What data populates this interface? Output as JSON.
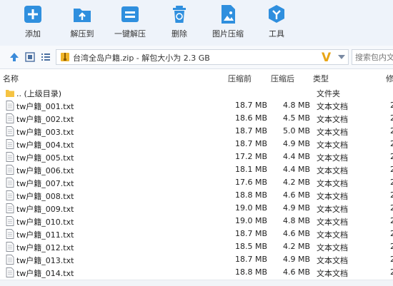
{
  "toolbar": {
    "items": [
      {
        "label": "添加",
        "icon": "add-icon"
      },
      {
        "label": "解压到",
        "icon": "extract-to-icon"
      },
      {
        "label": "一键解压",
        "icon": "one-click-extract-icon"
      },
      {
        "label": "删除",
        "icon": "delete-icon"
      },
      {
        "label": "图片压缩",
        "icon": "image-compress-icon"
      },
      {
        "label": "工具",
        "icon": "tools-icon"
      }
    ]
  },
  "address": {
    "path": "台湾全岛户籍.zip - 解包大小为 2.3 GB",
    "search_placeholder": "搜索包内文件",
    "search_value": ""
  },
  "columns": {
    "name": "名称",
    "size": "压缩前",
    "compressed": "压缩后",
    "type": "类型",
    "modified": "修"
  },
  "parent_row": {
    "name": ".. (上级目录)",
    "type": "文件夹"
  },
  "files": [
    {
      "name": "tw户籍_001.txt",
      "size": "18.7 MB",
      "compressed": "4.8 MB",
      "type": "文本文档",
      "modified": "2"
    },
    {
      "name": "tw户籍_002.txt",
      "size": "18.6 MB",
      "compressed": "4.5 MB",
      "type": "文本文档",
      "modified": "2"
    },
    {
      "name": "tw户籍_003.txt",
      "size": "18.7 MB",
      "compressed": "5.0 MB",
      "type": "文本文档",
      "modified": "2"
    },
    {
      "name": "tw户籍_004.txt",
      "size": "18.7 MB",
      "compressed": "4.9 MB",
      "type": "文本文档",
      "modified": "2"
    },
    {
      "name": "tw户籍_005.txt",
      "size": "17.2 MB",
      "compressed": "4.4 MB",
      "type": "文本文档",
      "modified": "2"
    },
    {
      "name": "tw户籍_006.txt",
      "size": "18.1 MB",
      "compressed": "4.4 MB",
      "type": "文本文档",
      "modified": "2"
    },
    {
      "name": "tw户籍_007.txt",
      "size": "17.6 MB",
      "compressed": "4.2 MB",
      "type": "文本文档",
      "modified": "2"
    },
    {
      "name": "tw户籍_008.txt",
      "size": "18.8 MB",
      "compressed": "4.6 MB",
      "type": "文本文档",
      "modified": "2"
    },
    {
      "name": "tw户籍_009.txt",
      "size": "19.0 MB",
      "compressed": "4.9 MB",
      "type": "文本文档",
      "modified": "2"
    },
    {
      "name": "tw户籍_010.txt",
      "size": "19.0 MB",
      "compressed": "4.8 MB",
      "type": "文本文档",
      "modified": "2"
    },
    {
      "name": "tw户籍_011.txt",
      "size": "18.7 MB",
      "compressed": "4.6 MB",
      "type": "文本文档",
      "modified": "2"
    },
    {
      "name": "tw户籍_012.txt",
      "size": "18.5 MB",
      "compressed": "4.2 MB",
      "type": "文本文档",
      "modified": "2"
    },
    {
      "name": "tw户籍_013.txt",
      "size": "18.7 MB",
      "compressed": "4.9 MB",
      "type": "文本文档",
      "modified": "2"
    },
    {
      "name": "tw户籍_014.txt",
      "size": "18.8 MB",
      "compressed": "4.6 MB",
      "type": "文本文档",
      "modified": "2"
    }
  ],
  "colors": {
    "accent": "#2f8fde",
    "toolbar_bg": "#eef3fa",
    "folder": "#f5c342",
    "v_mark": "#e8a516"
  }
}
